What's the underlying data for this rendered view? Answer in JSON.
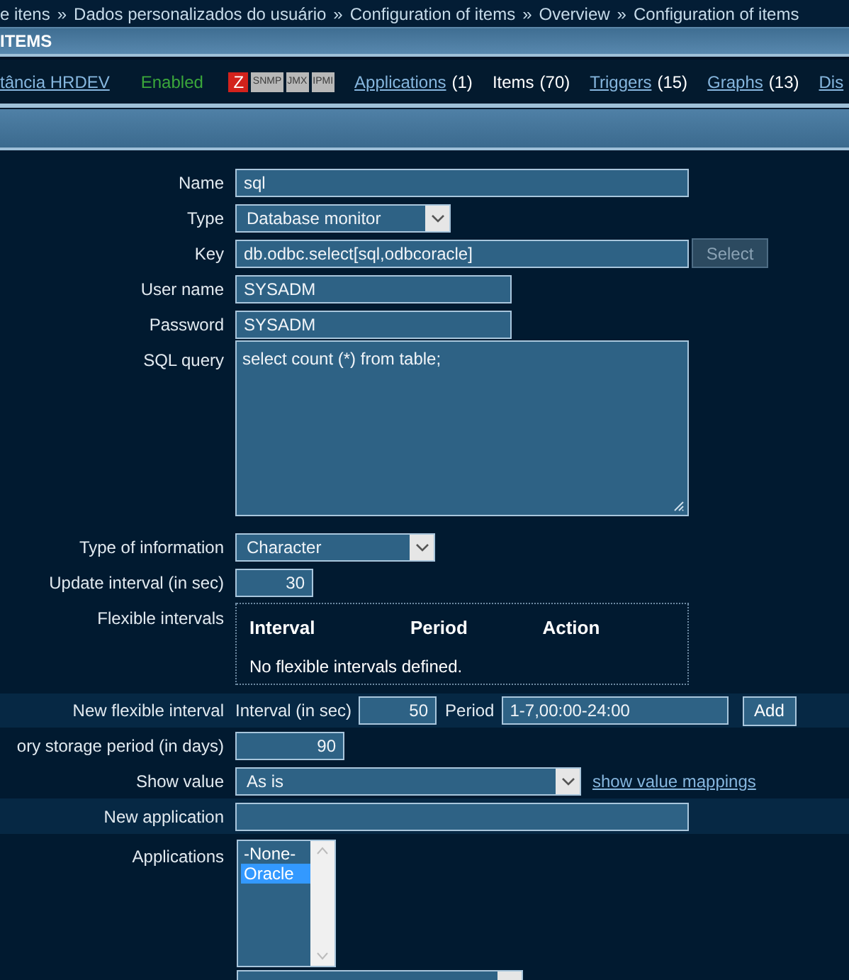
{
  "breadcrumbs": [
    "e itens",
    "Dados personalizados do usuário",
    "Configuration of items",
    "Overview",
    "Configuration of items"
  ],
  "breadcrumb_separator": "»",
  "title": "ITEMS",
  "host": {
    "name": "tância HRDEV",
    "status": "Enabled"
  },
  "interfaces": [
    {
      "label": "Z",
      "available": true
    },
    {
      "label": "SNMP",
      "available": false
    },
    {
      "label": "JMX",
      "available": false
    },
    {
      "label": "IPMI",
      "available": false
    }
  ],
  "tabs": [
    {
      "label": "Applications",
      "count": "(1)",
      "selected": false
    },
    {
      "label": "Items",
      "count": "(70)",
      "selected": true
    },
    {
      "label": "Triggers",
      "count": "(15)",
      "selected": false
    },
    {
      "label": "Graphs",
      "count": "(13)",
      "selected": false
    },
    {
      "label": "Dis",
      "selected": false
    }
  ],
  "form": {
    "name": {
      "label": "Name",
      "value": "sql"
    },
    "type": {
      "label": "Type",
      "value": "Database monitor"
    },
    "key": {
      "label": "Key",
      "value": "db.odbc.select[sql,odbcoracle]",
      "button": "Select",
      "button_disabled": true
    },
    "user_name": {
      "label": "User name",
      "value": "SYSADM"
    },
    "password": {
      "label": "Password",
      "value": "SYSADM"
    },
    "sql_query": {
      "label": "SQL query",
      "value": "select count (*) from table;"
    },
    "type_of_information": {
      "label": "Type of information",
      "value": "Character"
    },
    "update_interval": {
      "label": "Update interval (in sec)",
      "value": "30"
    },
    "flexible_intervals": {
      "label": "Flexible intervals",
      "columns": [
        "Interval",
        "Period",
        "Action"
      ],
      "empty_message": "No flexible intervals defined."
    },
    "new_flexible_interval": {
      "label": "New flexible interval",
      "interval_label": "Interval (in sec)",
      "interval_value": "50",
      "period_label": "Period",
      "period_value": "1-7,00:00-24:00",
      "button": "Add"
    },
    "history": {
      "label": "ory storage period (in days)",
      "value": "90"
    },
    "show_value": {
      "label": "Show value",
      "value": "As is",
      "link": "show value mappings"
    },
    "new_application": {
      "label": "New application"
    },
    "applications": {
      "label": "Applications",
      "options": [
        {
          "label": "-None-",
          "selected": false
        },
        {
          "label": "Oracle",
          "selected": true
        }
      ]
    },
    "next_field": {
      "kind": "select"
    }
  }
}
